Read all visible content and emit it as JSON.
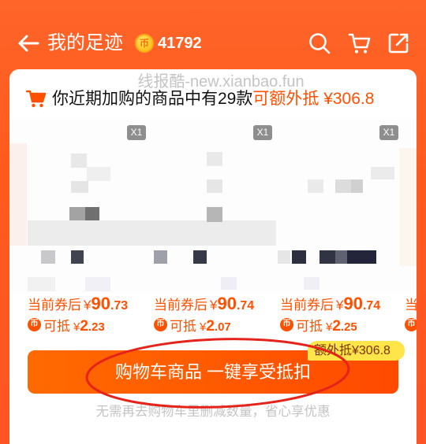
{
  "header": {
    "title": "我的足迹",
    "coin_balance": "41792"
  },
  "icons": {
    "coin_glyph": "币",
    "back": "back-arrow-icon",
    "search": "search-icon",
    "cart": "cart-icon",
    "share": "share-icon",
    "summary_cart": "shopping-cart-icon",
    "coin": "coin-icon"
  },
  "colors": {
    "brand": "#FF5A1E",
    "accent": "#FF5000",
    "button_start": "#FF6A00",
    "button_end": "#FF4A00",
    "badge_bg": "#FFE44A",
    "badge_text": "#7A3300",
    "annotation": "#E5231B",
    "muted": "#C4C4C4"
  },
  "watermark": "线报酷-new.xianbao.fun",
  "summary": {
    "prefix": "你近期加购的商品中有29款",
    "highlight": "可额外抵 ¥306.8"
  },
  "products": [
    {
      "quantity": "X1",
      "price": {
        "label": "当前券后",
        "symbol": "¥",
        "integer": "90",
        "decimal": ".73"
      },
      "deduct": {
        "label": "可抵",
        "symbol": "¥",
        "integer": "2",
        "decimal": ".23"
      }
    },
    {
      "quantity": "X1",
      "price": {
        "label": "当前券后",
        "symbol": "¥",
        "integer": "90",
        "decimal": ".74"
      },
      "deduct": {
        "label": "可抵",
        "symbol": "¥",
        "integer": "2",
        "decimal": ".07"
      }
    },
    {
      "quantity": "X1",
      "price": {
        "label": "当前券后",
        "symbol": "¥",
        "integer": "90",
        "decimal": ".74"
      },
      "deduct": {
        "label": "可抵",
        "symbol": "¥",
        "integer": "2",
        "decimal": ".25"
      }
    },
    {
      "price": {
        "label": "当前券后"
      }
    }
  ],
  "badge": "额外抵¥306.8",
  "button": "购物车商品 一键享受抵扣",
  "footer_note": "无需再去购物车里删减数量，省心享优惠"
}
